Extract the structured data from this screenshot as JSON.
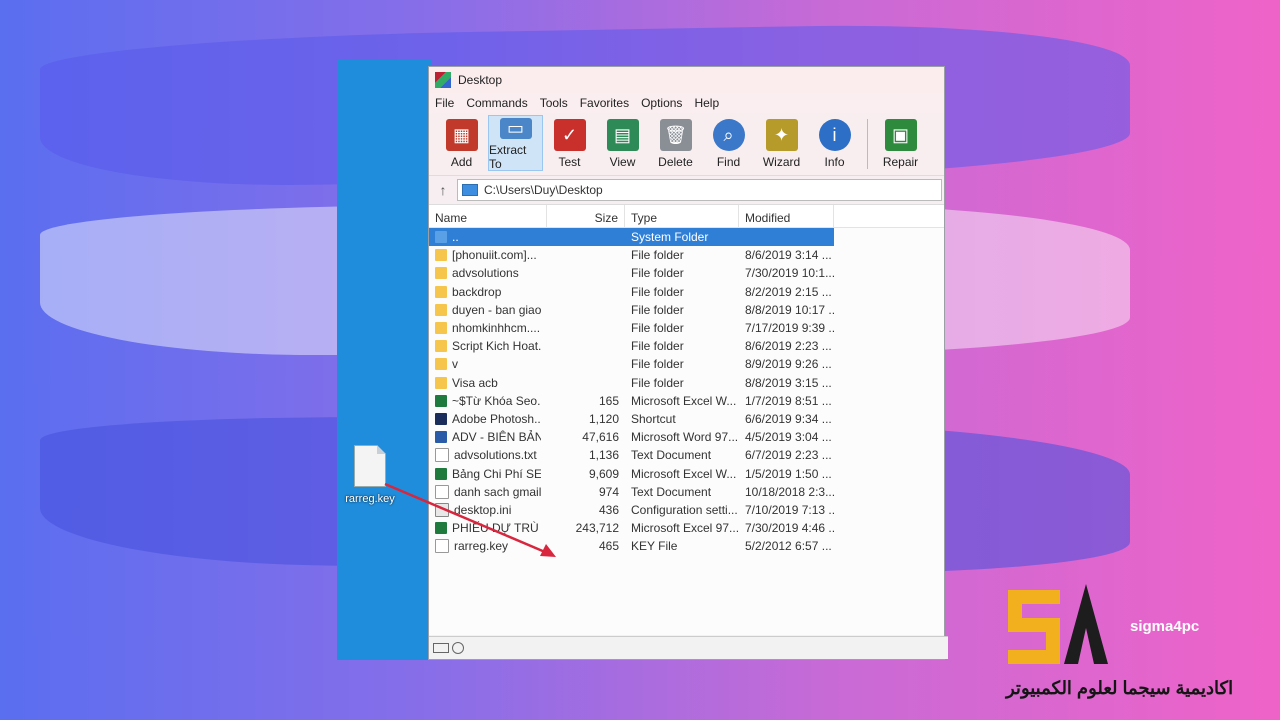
{
  "desktop_icon": {
    "label": "rarreg.key"
  },
  "window": {
    "title": "Desktop"
  },
  "menu": [
    "File",
    "Commands",
    "Tools",
    "Favorites",
    "Options",
    "Help"
  ],
  "toolbar": [
    {
      "label": "Add",
      "icon": "add-archive-icon",
      "color": "#c0392b"
    },
    {
      "label": "Extract To",
      "icon": "extract-folder-icon",
      "color": "#4a86c8"
    },
    {
      "label": "Test",
      "icon": "test-clipboard-icon",
      "color": "#c9302c"
    },
    {
      "label": "View",
      "icon": "view-book-icon",
      "color": "#2e8b57"
    },
    {
      "label": "Delete",
      "icon": "trash-icon",
      "color": "#8a8f96"
    },
    {
      "label": "Find",
      "icon": "magnifier-icon",
      "color": "#3b78c9"
    },
    {
      "label": "Wizard",
      "icon": "wand-icon",
      "color": "#b79b2a"
    },
    {
      "label": "Info",
      "icon": "info-icon",
      "color": "#2d6fc6"
    },
    {
      "label": "Repair",
      "icon": "repair-icon",
      "color": "#2e8b3e"
    }
  ],
  "address": {
    "path": "C:\\Users\\Duy\\Desktop"
  },
  "columns": {
    "name": "Name",
    "size": "Size",
    "type": "Type",
    "modified": "Modified"
  },
  "files": [
    {
      "name": "..",
      "size": "",
      "type": "System Folder",
      "modified": "",
      "icon": "sysf"
    },
    {
      "name": "[phonuiit.com]...",
      "size": "",
      "type": "File folder",
      "modified": "8/6/2019 3:14 ...",
      "icon": "folder"
    },
    {
      "name": "advsolutions",
      "size": "",
      "type": "File folder",
      "modified": "7/30/2019 10:1...",
      "icon": "folder"
    },
    {
      "name": "backdrop",
      "size": "",
      "type": "File folder",
      "modified": "8/2/2019 2:15 ...",
      "icon": "folder"
    },
    {
      "name": "duyen - ban giao",
      "size": "",
      "type": "File folder",
      "modified": "8/8/2019 10:17 ...",
      "icon": "folder"
    },
    {
      "name": "nhomkinhhcm....",
      "size": "",
      "type": "File folder",
      "modified": "7/17/2019 9:39 ...",
      "icon": "folder"
    },
    {
      "name": "Script Kich Hoat...",
      "size": "",
      "type": "File folder",
      "modified": "8/6/2019 2:23 ...",
      "icon": "folder"
    },
    {
      "name": "v",
      "size": "",
      "type": "File folder",
      "modified": "8/9/2019 9:26 ...",
      "icon": "folder"
    },
    {
      "name": "Visa acb",
      "size": "",
      "type": "File folder",
      "modified": "8/8/2019 3:15 ...",
      "icon": "folder"
    },
    {
      "name": "~$Từ Khóa Seo....",
      "size": "165",
      "type": "Microsoft Excel W...",
      "modified": "1/7/2019 8:51 ...",
      "icon": "xls"
    },
    {
      "name": "Adobe Photosh...",
      "size": "1,120",
      "type": "Shortcut",
      "modified": "6/6/2019 9:34 ...",
      "icon": "ps"
    },
    {
      "name": "ADV - BIÊN BẢN...",
      "size": "47,616",
      "type": "Microsoft Word 97...",
      "modified": "4/5/2019 3:04 ...",
      "icon": "word"
    },
    {
      "name": "advsolutions.txt",
      "size": "1,136",
      "type": "Text Document",
      "modified": "6/7/2019 2:23 ...",
      "icon": "txt"
    },
    {
      "name": "Bảng Chi Phí SE...",
      "size": "9,609",
      "type": "Microsoft Excel W...",
      "modified": "1/5/2019 1:50 ...",
      "icon": "xls"
    },
    {
      "name": "danh sach gmail...",
      "size": "974",
      "type": "Text Document",
      "modified": "10/18/2018 2:3...",
      "icon": "txt"
    },
    {
      "name": "desktop.ini",
      "size": "436",
      "type": "Configuration setti...",
      "modified": "7/10/2019 7:13 ...",
      "icon": "ini"
    },
    {
      "name": "PHIẾU DỰ TRÙ ...",
      "size": "243,712",
      "type": "Microsoft Excel 97...",
      "modified": "7/30/2019 4:46 ...",
      "icon": "xls"
    },
    {
      "name": "rarreg.key",
      "size": "465",
      "type": "KEY File",
      "modified": "5/2/2012 6:57 ...",
      "icon": "txt"
    }
  ],
  "logo": {
    "brand": "sigma4pc",
    "arabic": "اكاديمية سيجما لعلوم الكمبيوتر",
    "accent": "#f2b01e"
  }
}
